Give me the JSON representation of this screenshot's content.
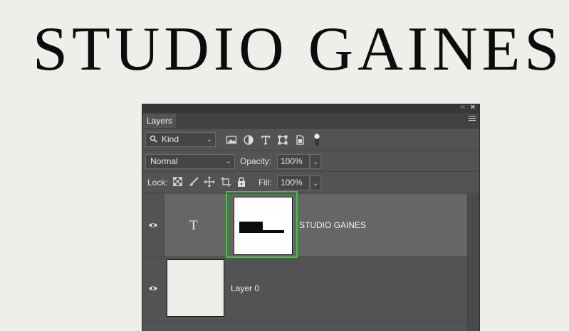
{
  "headline": "STUDIO GAINES",
  "panel": {
    "tab_label": "Layers",
    "collapse_glyph": "‹‹",
    "close_glyph": "×",
    "filter": {
      "kind_label": "Kind"
    },
    "blend_mode": "Normal",
    "opacity_label": "Opacity:",
    "opacity_value": "100%",
    "lock_label": "Lock:",
    "fill_label": "Fill:",
    "fill_value": "100%"
  },
  "layers": [
    {
      "type_glyph": "T",
      "name": "STUDIO GAINES",
      "selected": true
    },
    {
      "name": "Layer 0",
      "selected": false
    }
  ],
  "colors": {
    "highlight": "#2fd12f",
    "panel_bg": "#535353",
    "selected_row": "#666666"
  },
  "icons": [
    "search-icon",
    "chevron-down-icon",
    "image-filter-icon",
    "adjustment-filter-icon",
    "type-filter-icon",
    "shape-filter-icon",
    "smart-object-filter-icon",
    "filter-toggle-icon",
    "lock-transparent-pixels-icon",
    "lock-image-pixels-icon",
    "lock-position-icon",
    "lock-artboard-icon",
    "lock-all-icon",
    "eye-icon",
    "panel-menu-icon"
  ]
}
